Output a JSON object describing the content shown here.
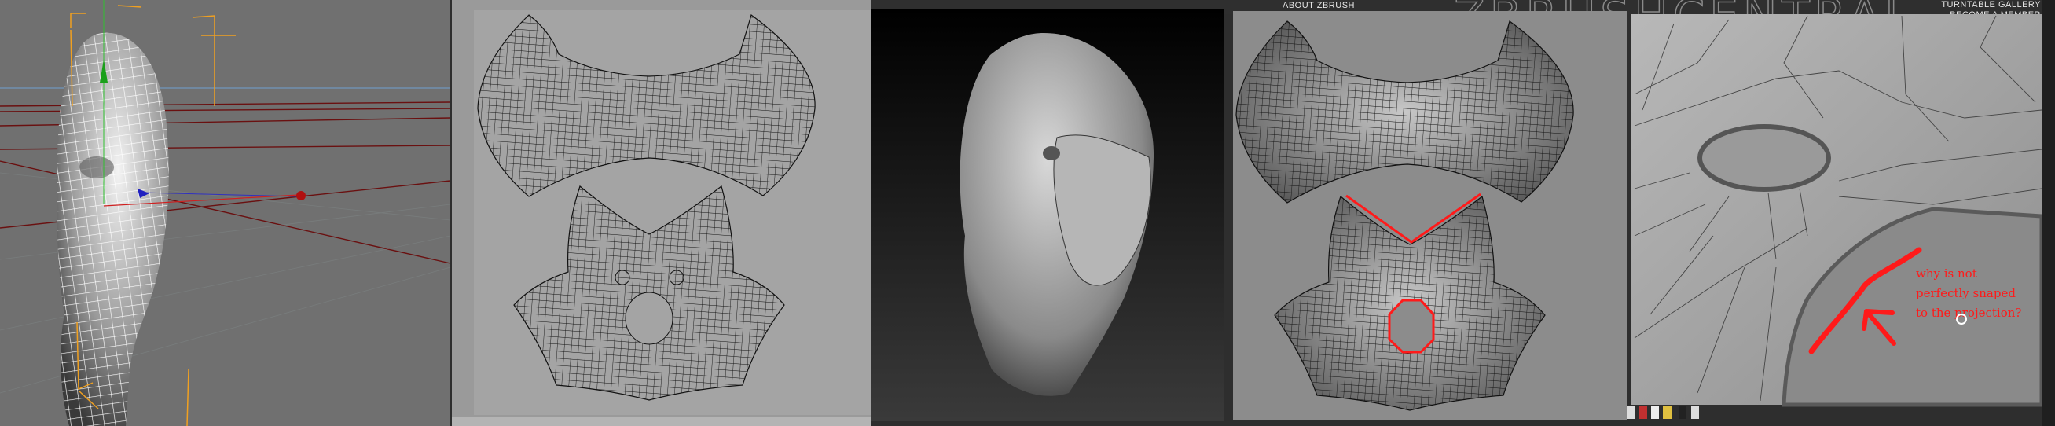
{
  "header": {
    "about_link": "ABOUT ZBRUSH",
    "logo": "ZBRUSHCENTRAL",
    "turntable_link": "TURNTABLE GALLERY",
    "member_link": "BECOME A MEMBER"
  },
  "annotation": {
    "lines": [
      "why is not",
      "perfectly snaped",
      "to the projection?"
    ],
    "color": "#ff1a1a"
  },
  "colors": {
    "viewport_bg": "#707070",
    "uv_bg": "#9c9c9c",
    "zbrush_bg": "#1c1c1c",
    "highlight": "#ff1a1a",
    "bracket": "#f0a020"
  }
}
